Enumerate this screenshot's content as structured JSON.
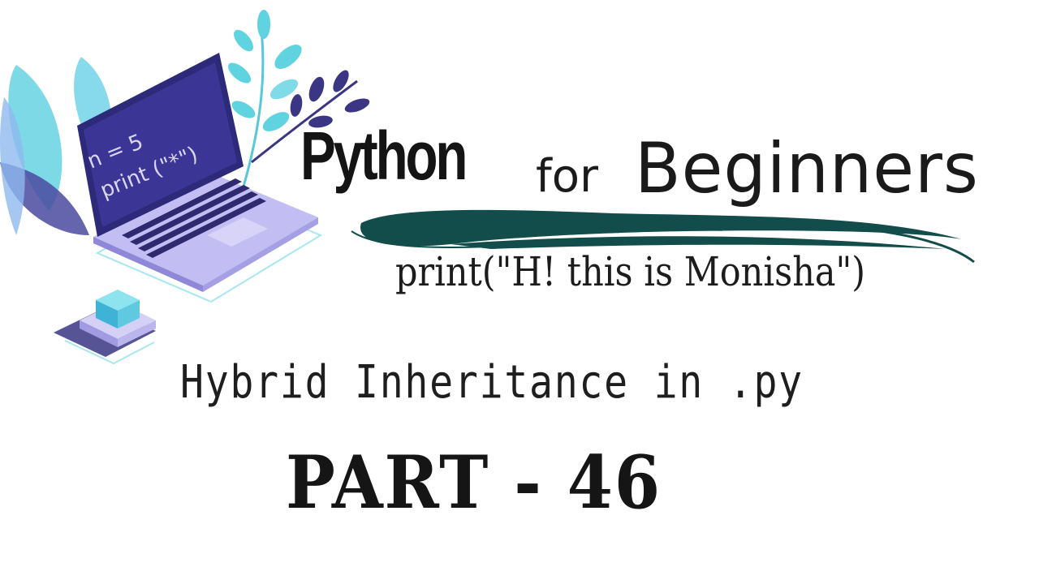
{
  "illustration": {
    "code_line_1": "n = 5",
    "code_line_2": "print (\"*\")",
    "colors": {
      "leaf_teal": "#5fd3df",
      "leaf_purple": "#3a3683",
      "laptop_screen": "#3b3596",
      "laptop_body": "#b9b3ee",
      "cube": "#4fb8d8"
    }
  },
  "title": {
    "python": "Python",
    "for": "for",
    "beginners": "Beginners"
  },
  "brush_color": "#134d4b",
  "subtitle": "print(\"H! this is Monisha\")",
  "topic": "Hybrid Inheritance in .py",
  "part": "PART - 46"
}
